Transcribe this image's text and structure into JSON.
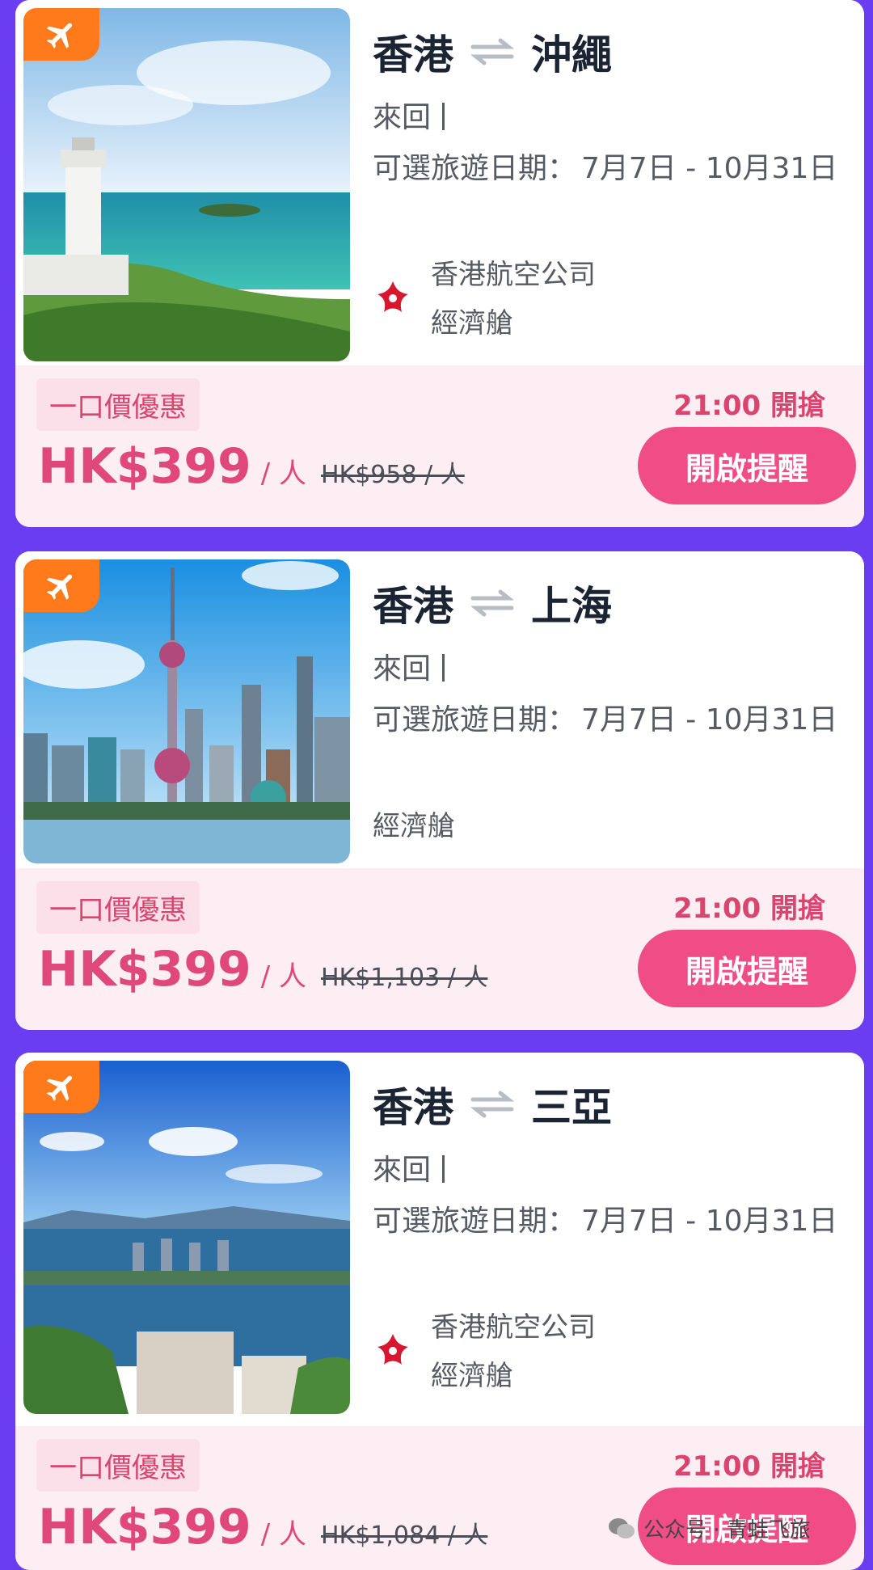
{
  "cards": [
    {
      "origin": "香港",
      "destination": "沖繩",
      "trip_type": "來回",
      "dates_label": "可選旅遊日期：",
      "dates_value": "7月7日 - 10月31日",
      "airline": "香港航空公司",
      "cabin": "經濟艙",
      "promo_tag": "一口價優惠",
      "price": "HK$399",
      "per_person": "/ 人",
      "original_price": "HK$958 / 人",
      "open_time": "21:00 開搶",
      "remind_label": "開啟提醒",
      "image_icon": "lighthouse-coast-photo"
    },
    {
      "origin": "香港",
      "destination": "上海",
      "trip_type": "來回",
      "dates_label": "可選旅遊日期：",
      "dates_value": "7月7日 - 10月31日",
      "cabin": "經濟艙",
      "promo_tag": "一口價優惠",
      "price": "HK$399",
      "per_person": "/ 人",
      "original_price": "HK$1,103 / 人",
      "open_time": "21:00 開搶",
      "remind_label": "開啟提醒",
      "image_icon": "shanghai-skyline-photo"
    },
    {
      "origin": "香港",
      "destination": "三亞",
      "trip_type": "來回",
      "dates_label": "可選旅遊日期：",
      "dates_value": "7月7日 - 10月31日",
      "airline": "香港航空公司",
      "cabin": "經濟艙",
      "promo_tag": "一口價優惠",
      "price": "HK$399",
      "per_person": "/ 人",
      "original_price": "HK$1,084 / 人",
      "open_time": "21:00 開搶",
      "remind_label": "開啟提醒",
      "image_icon": "sanya-bay-photo"
    }
  ],
  "watermark": "公众号 · 青蛙飞旅",
  "colors": {
    "background": "#6a3df0",
    "accent_pink": "#f04d86",
    "badge_orange": "#ff7a1a",
    "price_pink": "#e0487c"
  }
}
